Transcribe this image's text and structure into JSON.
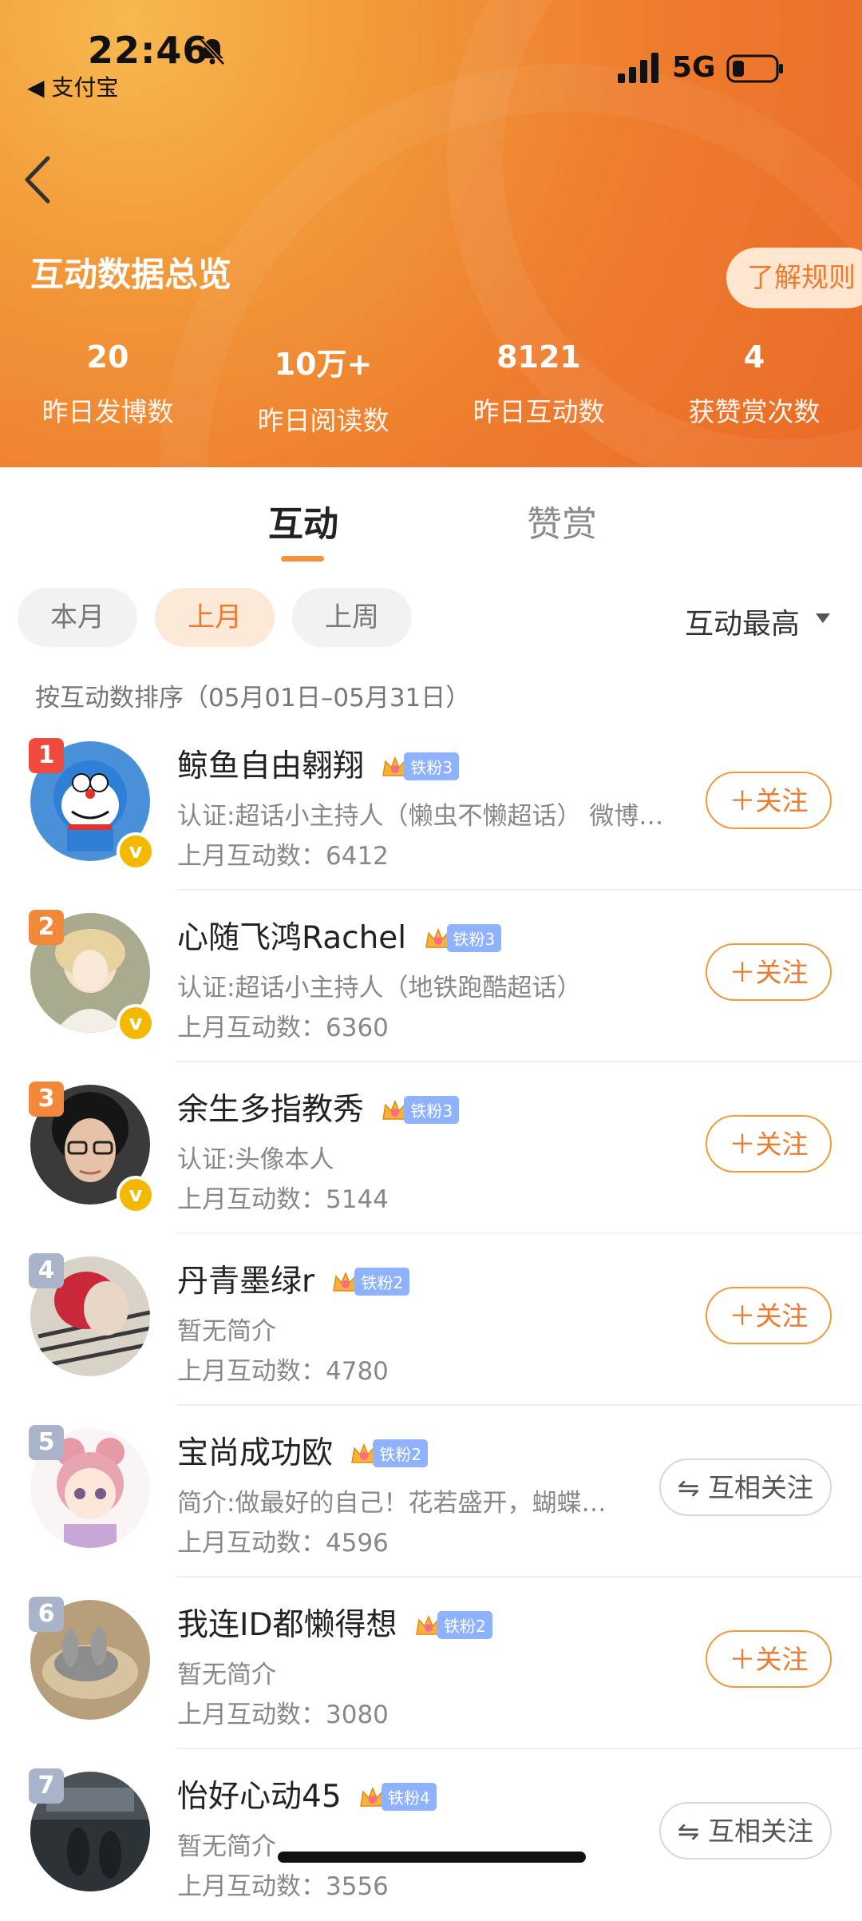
{
  "status_bar": {
    "time": "22:46",
    "back_app": "◀ 支付宝",
    "network": "5G"
  },
  "header": {
    "title": "互动数据总览",
    "rules_button": "了解规则",
    "stats": [
      {
        "value": "20",
        "label": "昨日发博数"
      },
      {
        "value": "10万+",
        "label": "昨日阅读数"
      },
      {
        "value": "8121",
        "label": "昨日互动数"
      },
      {
        "value": "4",
        "label": "获赞赏次数"
      }
    ]
  },
  "tabs": [
    {
      "label": "互动"
    },
    {
      "label": "赞赏"
    }
  ],
  "filters": [
    {
      "label": "本月"
    },
    {
      "label": "上月"
    },
    {
      "label": "上周"
    }
  ],
  "sort_label": "互动最高",
  "note": "按互动数排序（05月01日–05月31日）",
  "colors": {
    "accent": "#ee7a2e",
    "rank_red": "#f04a3e",
    "rank_orange": "#f3873a",
    "rank_gray": "#a9b3c9",
    "fan_tag": "#8fb2ff"
  },
  "list": [
    {
      "rank": "1",
      "name": "鲸鱼自由翱翔",
      "fan": "铁粉3",
      "desc": "认证:超话小主持人（懒虫不懒超话） 微博…",
      "count": "上月互动数：6412",
      "button": "＋关注",
      "verified": true
    },
    {
      "rank": "2",
      "name": "心随飞鸿Rachel",
      "fan": "铁粉3",
      "desc": "认证:超话小主持人（地铁跑酷超话）",
      "count": "上月互动数：6360",
      "button": "＋关注",
      "verified": true
    },
    {
      "rank": "3",
      "name": "余生多指教秀",
      "fan": "铁粉3",
      "desc": "认证:头像本人",
      "count": "上月互动数：5144",
      "button": "＋关注",
      "verified": true
    },
    {
      "rank": "4",
      "name": "丹青墨绿r",
      "fan": "铁粉2",
      "desc": "暂无简介",
      "count": "上月互动数：4780",
      "button": "＋关注",
      "verified": false
    },
    {
      "rank": "5",
      "name": "宝尚成功欧",
      "fan": "铁粉2",
      "desc": "简介:做最好的自己！花若盛开，蝴蝶…",
      "count": "上月互动数：4596",
      "button": "⇋ 互相关注",
      "verified": false
    },
    {
      "rank": "6",
      "name": "我连ID都懒得想",
      "fan": "铁粉2",
      "desc": "暂无简介",
      "count": "上月互动数：3080",
      "button": "＋关注",
      "verified": false
    },
    {
      "rank": "7",
      "name": "怡好心动45",
      "fan": "铁粉4",
      "desc": "暂无简介",
      "count": "上月互动数：3556",
      "button": "⇋ 互相关注",
      "verified": false
    }
  ]
}
